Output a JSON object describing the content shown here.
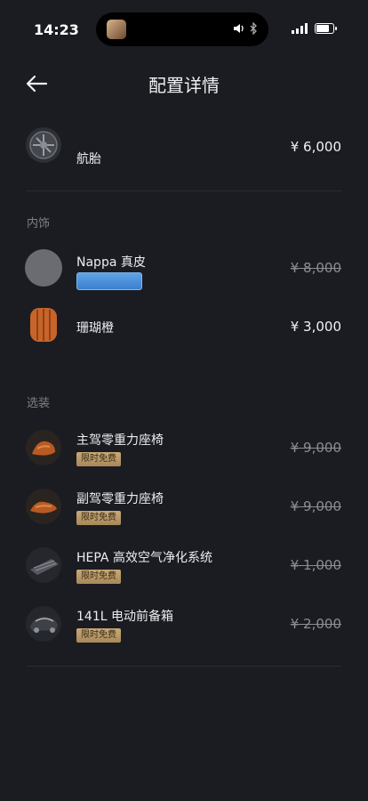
{
  "status_bar": {
    "time": "14:23"
  },
  "header": {
    "title": "配置详情"
  },
  "tire": {
    "name": "航胎",
    "price": "¥ 6,000"
  },
  "interior": {
    "section_label": "内饰",
    "items": [
      {
        "name": "Nappa 真皮",
        "price": "¥ 8,000",
        "strike": true
      },
      {
        "name": "珊瑚橙",
        "price": "¥ 3,000",
        "strike": false
      }
    ]
  },
  "options": {
    "section_label": "选装",
    "badge": "限时免费",
    "items": [
      {
        "name": "主驾零重力座椅",
        "price": "¥ 9,000",
        "badge": "限时免费"
      },
      {
        "name": "副驾零重力座椅",
        "price": "¥ 9,000",
        "badge": "限时免费"
      },
      {
        "name": "HEPA 高效空气净化系统",
        "price": "¥ 1,000",
        "badge": "限时免费"
      },
      {
        "name": "141L 电动前备箱",
        "price": "¥ 2,000",
        "badge": "限时免费"
      }
    ]
  },
  "colors": {
    "background": "#1a1c22",
    "badge_gold": "#c8a978",
    "chip_blue": "#3b7fd0",
    "orange": "#c8642a"
  }
}
